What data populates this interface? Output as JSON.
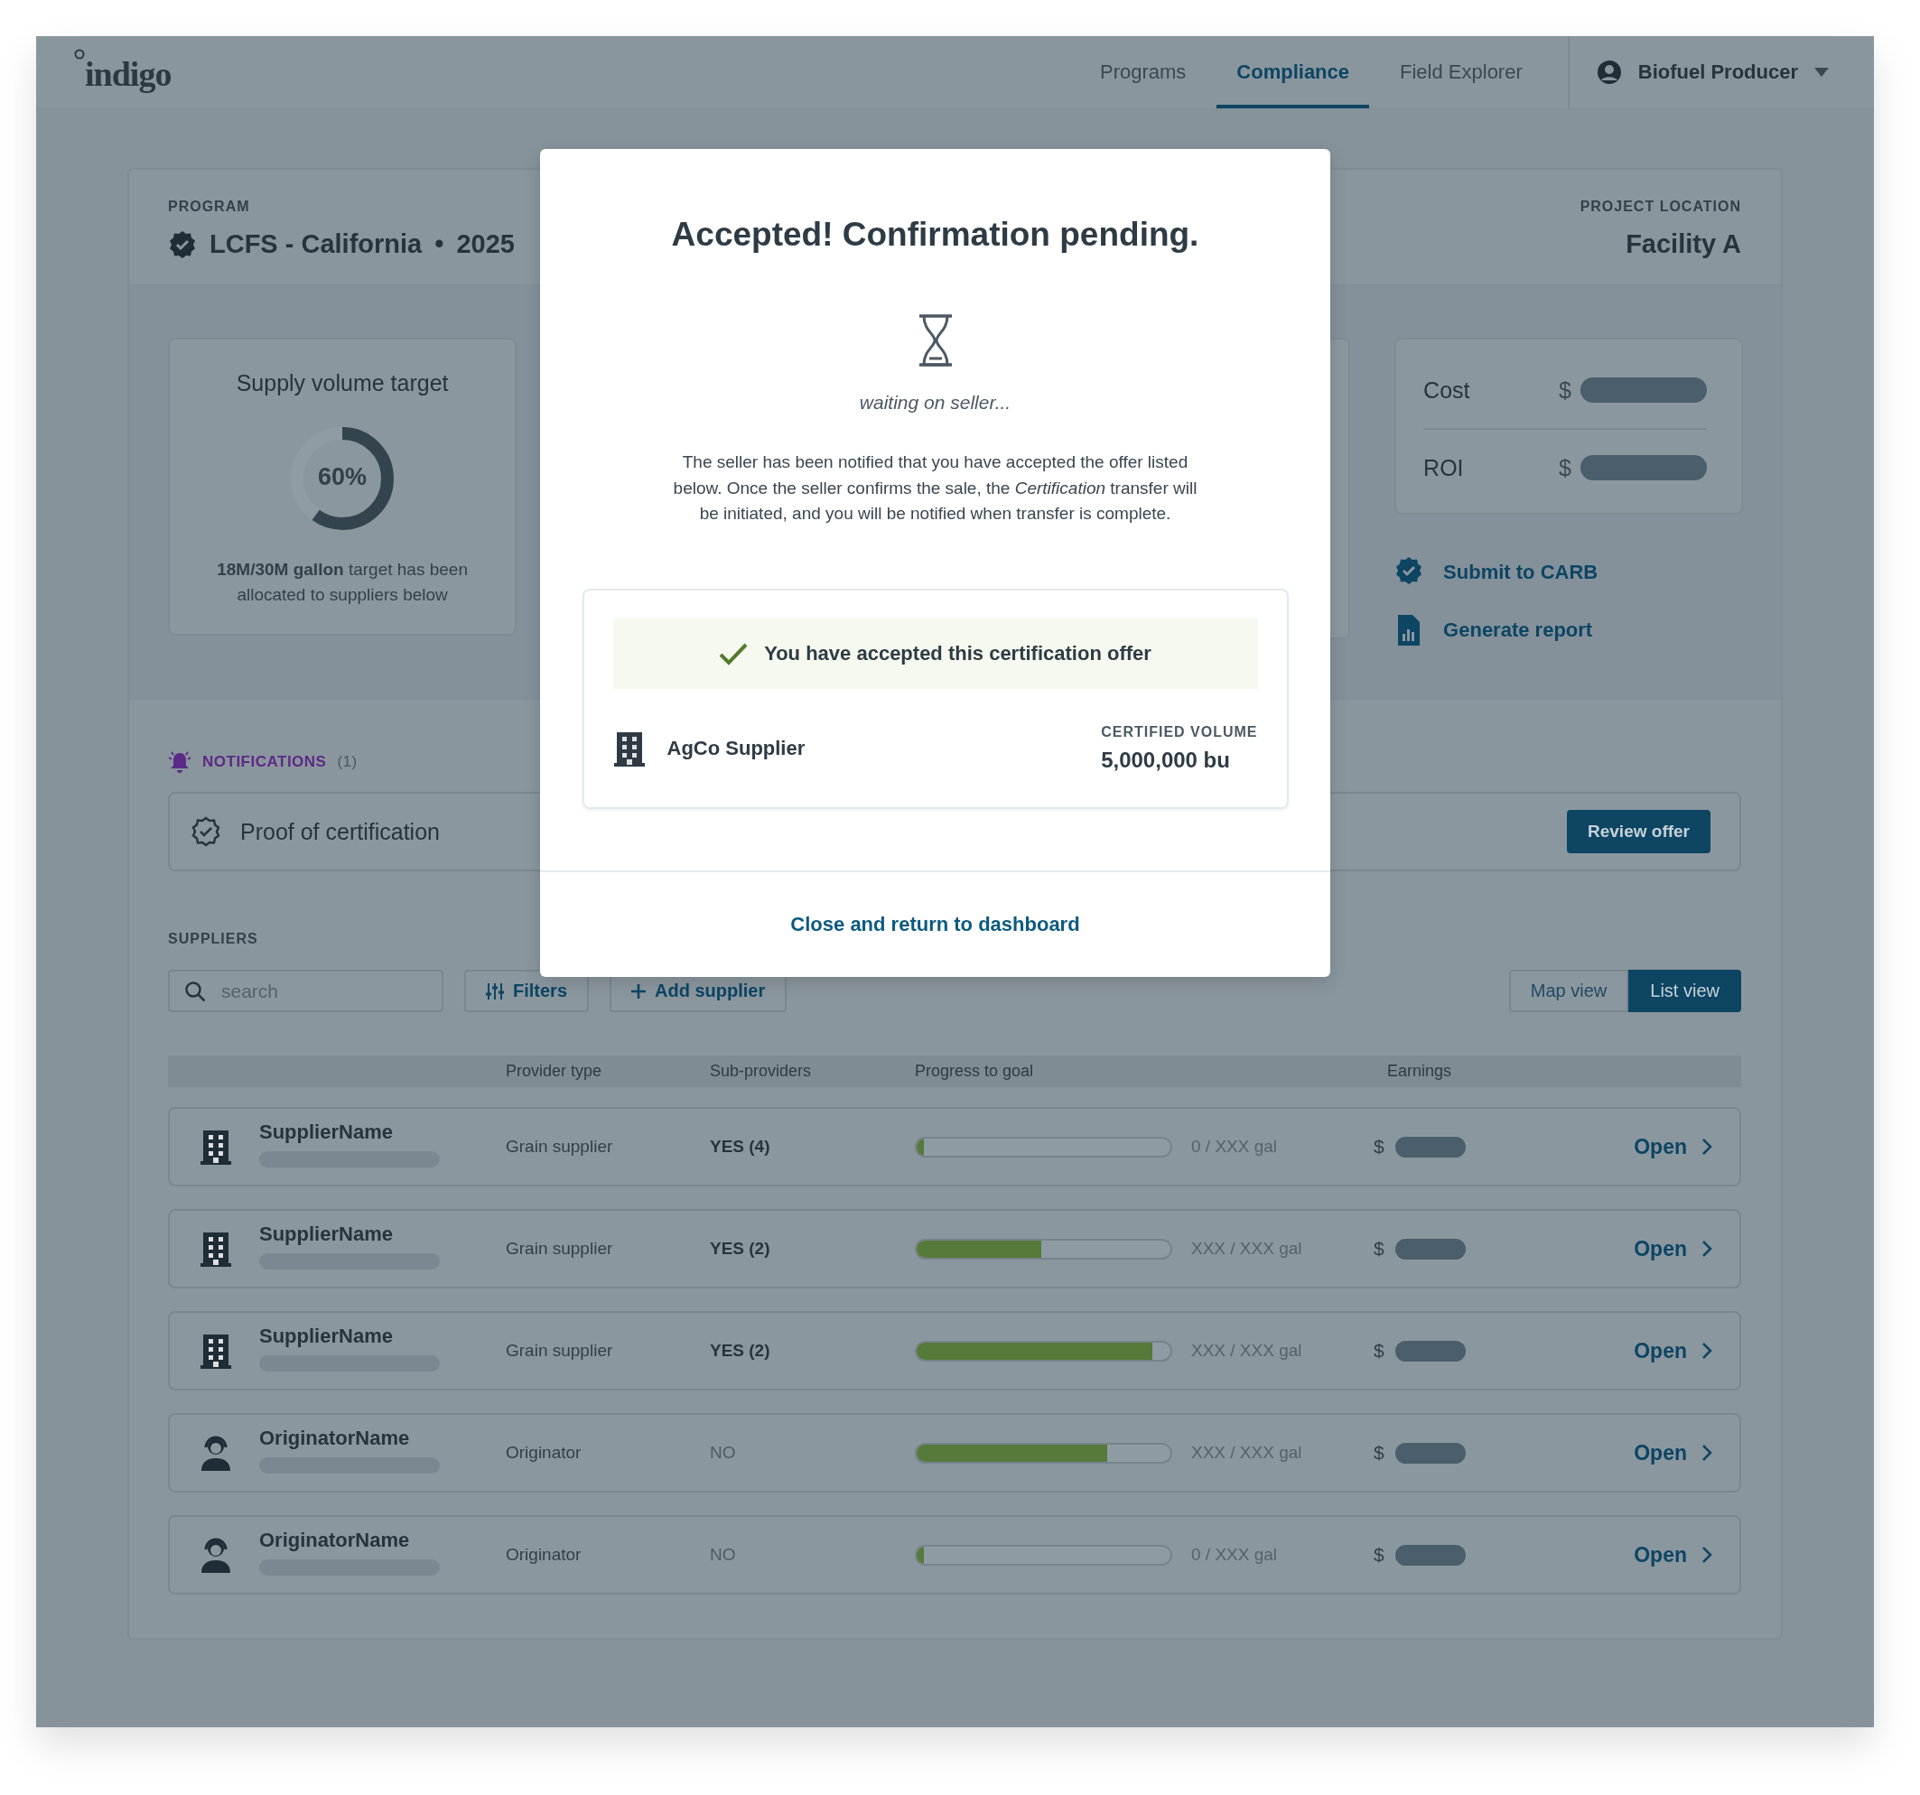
{
  "header": {
    "logo": "indigo",
    "nav": [
      {
        "label": "Programs",
        "selected": false
      },
      {
        "label": "Compliance",
        "selected": true
      },
      {
        "label": "Field Explorer",
        "selected": false
      }
    ],
    "user": "Biofuel Producer"
  },
  "program": {
    "label": "PROGRAM",
    "name": "LCFS - California",
    "separator": "•",
    "year": "2025",
    "location_label": "PROJECT LOCATION",
    "location": "Facility A"
  },
  "supply_card": {
    "title": "Supply volume target",
    "percent": "60%",
    "level": 0.6,
    "description": "**18M/30M gallon** target has been allocated to suppliers below"
  },
  "finance": [
    {
      "label": "Cost",
      "currency": "$"
    },
    {
      "label": "ROI",
      "currency": "$"
    }
  ],
  "actions": [
    {
      "label": "Submit to CARB",
      "kind": "submit"
    },
    {
      "label": "Generate report",
      "kind": "report"
    }
  ],
  "notifications": {
    "label": "NOTIFICATIONS",
    "count": "(1)",
    "items": [
      {
        "title": "Proof of certification",
        "action": "Review offer"
      }
    ]
  },
  "suppliers": {
    "label": "SUPPLIERS",
    "search_placeholder": "search",
    "filters": "Filters",
    "add": "Add supplier",
    "views": [
      {
        "label": "Map view",
        "selected": false
      },
      {
        "label": "List view",
        "selected": true
      }
    ],
    "columns": [
      "Provider type",
      "Sub-providers",
      "Progress to goal",
      "Earnings"
    ],
    "rows": [
      {
        "kind": "supplier",
        "name": "SupplierName",
        "provider_type": "Grain supplier",
        "sub_providers": "YES (4)",
        "has_sub_providers": true,
        "level": 0.03,
        "progress": "0 / XXX gal",
        "currency": "$",
        "action": "Open"
      },
      {
        "kind": "supplier",
        "name": "SupplierName",
        "provider_type": "Grain supplier",
        "sub_providers": "YES (2)",
        "has_sub_providers": true,
        "level": 0.49,
        "progress": "XXX / XXX gal",
        "currency": "$",
        "action": "Open"
      },
      {
        "kind": "supplier",
        "name": "SupplierName",
        "provider_type": "Grain supplier",
        "sub_providers": "YES (2)",
        "has_sub_providers": true,
        "level": 0.93,
        "progress": "XXX / XXX gal",
        "currency": "$",
        "action": "Open"
      },
      {
        "kind": "originator",
        "name": "OriginatorName",
        "provider_type": "Originator",
        "sub_providers": "NO",
        "has_sub_providers": false,
        "level": 0.75,
        "progress": "XXX / XXX gal",
        "currency": "$",
        "action": "Open"
      },
      {
        "kind": "originator",
        "name": "OriginatorName",
        "provider_type": "Originator",
        "sub_providers": "NO",
        "has_sub_providers": false,
        "level": 0.03,
        "progress": "0 / XXX gal",
        "currency": "$",
        "action": "Open"
      }
    ]
  },
  "modal": {
    "title": "Accepted! Confirmation pending.",
    "status": "waiting on seller...",
    "message": "The seller has been notified that you have accepted the offer listed below. Once the seller confirms the sale, the *Certification* transfer will be initiated, and you will be notified when transfer is complete.",
    "banner": "You have accepted this certification offer",
    "supplier": "AgCo Supplier",
    "volume_label": "CERTIFIED VOLUME",
    "volume": "5,000,000 bu",
    "close": "Close and return to dashboard"
  }
}
